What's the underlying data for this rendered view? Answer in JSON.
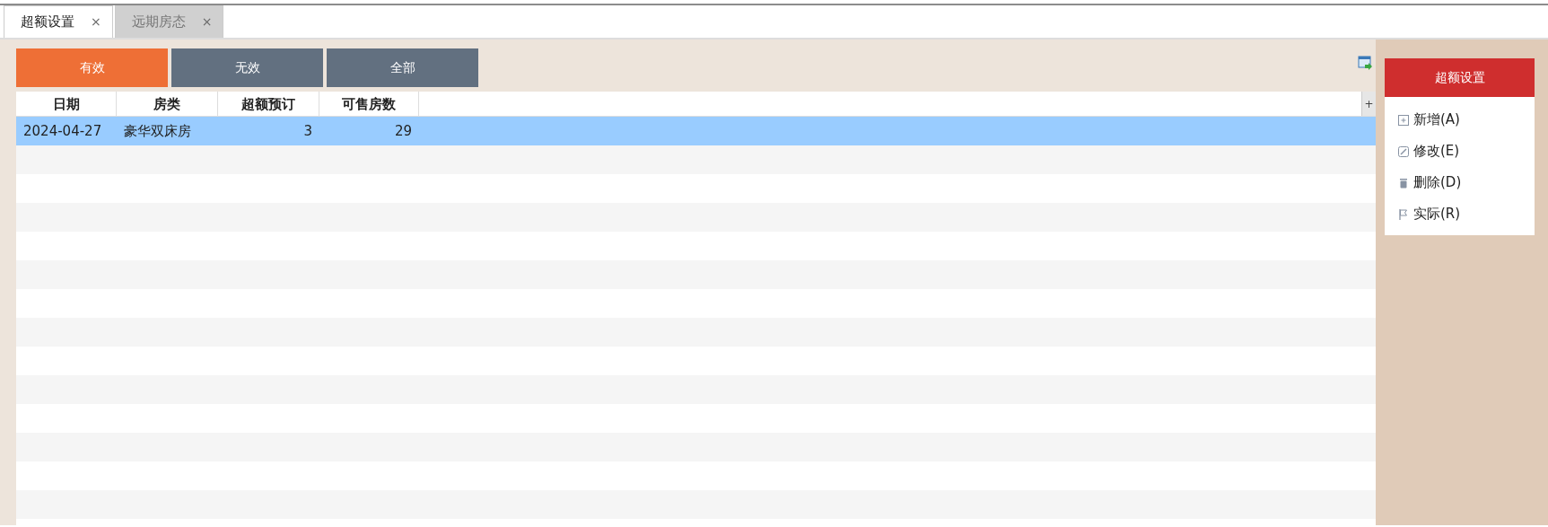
{
  "tabs": [
    {
      "label": "超额设置",
      "close": "×",
      "selected": true
    },
    {
      "label": "远期房态",
      "close": "×",
      "selected": false
    }
  ],
  "filters": [
    {
      "label": "有效",
      "selected": true
    },
    {
      "label": "无效",
      "selected": false
    },
    {
      "label": "全部",
      "selected": false
    }
  ],
  "table": {
    "columns": [
      {
        "label": "日期",
        "kind": "text"
      },
      {
        "label": "房类",
        "kind": "text"
      },
      {
        "label": "超额预订",
        "kind": "number"
      },
      {
        "label": "可售房数",
        "kind": "number"
      }
    ],
    "header_button": "+",
    "rows": [
      {
        "cells": [
          "2024-04-27",
          "豪华双床房",
          "3",
          "29"
        ],
        "selected": true
      }
    ]
  },
  "side_panel": {
    "title": "超额设置",
    "actions": [
      {
        "kind": "add",
        "label": "新增(A)"
      },
      {
        "kind": "edit",
        "label": "修改(E)"
      },
      {
        "kind": "delete",
        "label": "删除(D)"
      },
      {
        "kind": "flag",
        "label": "实际(R)"
      }
    ]
  }
}
